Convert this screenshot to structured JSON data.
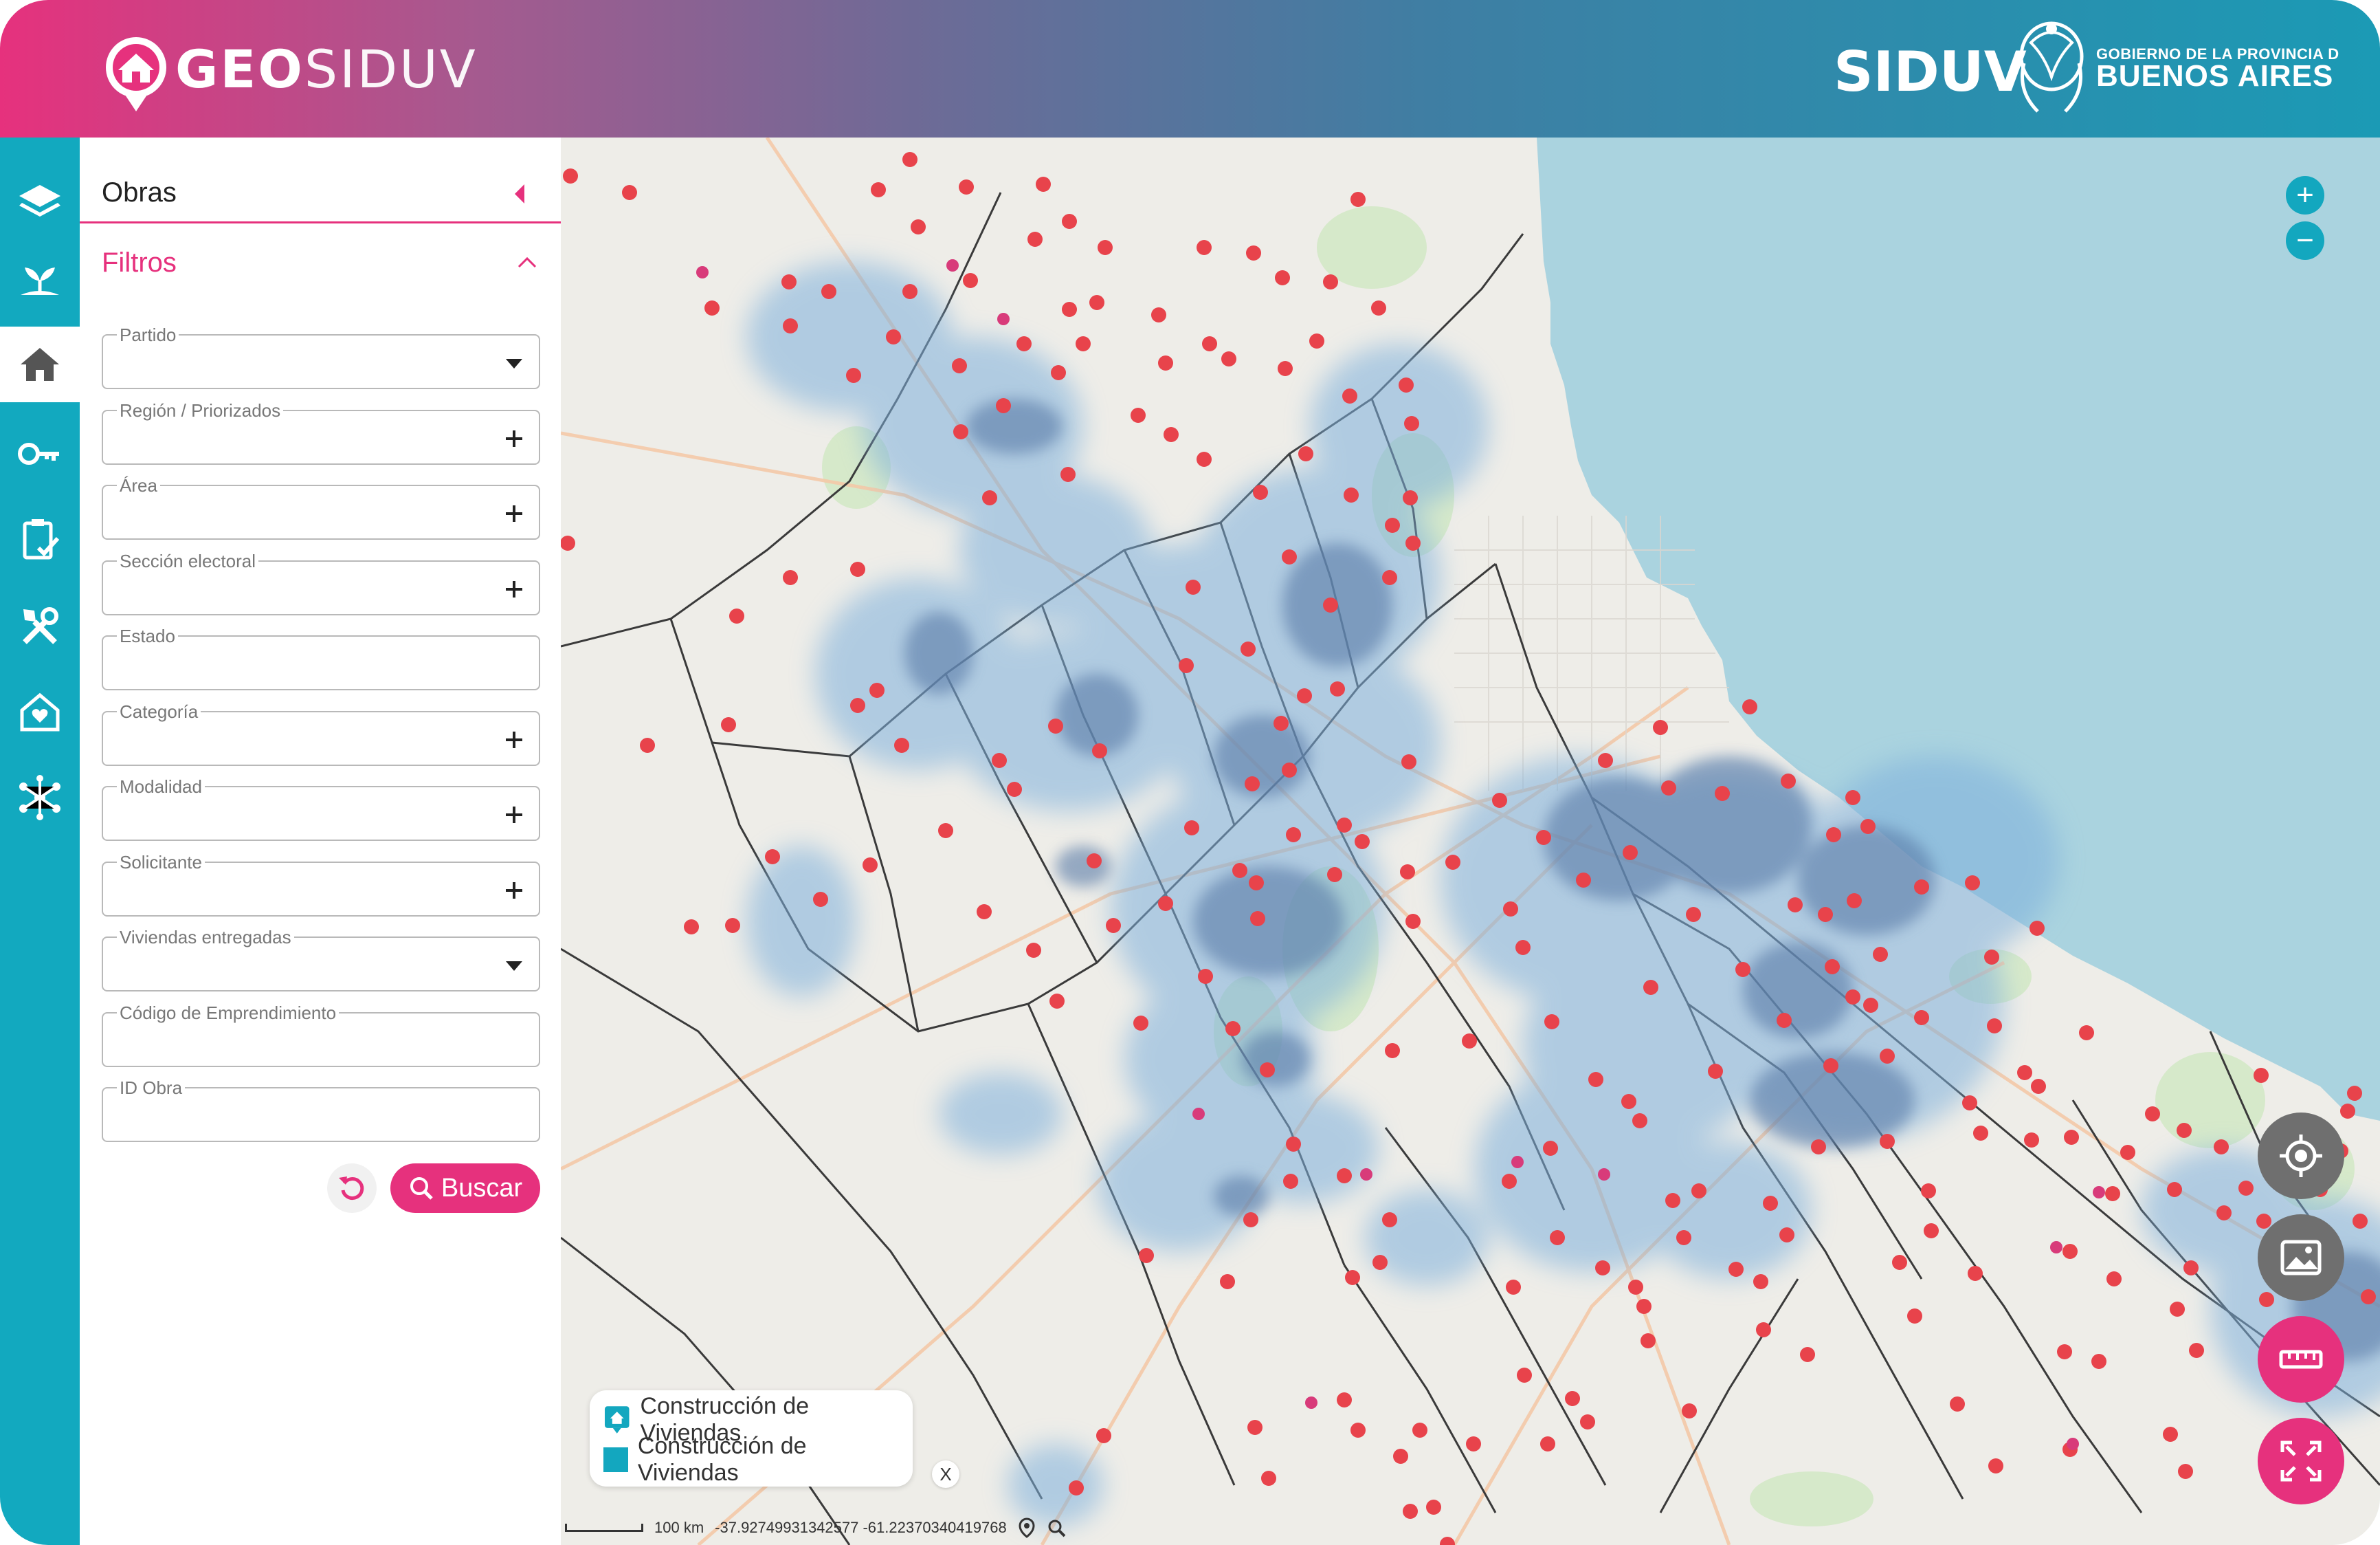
{
  "header": {
    "logo_bold": "GEO",
    "logo_thin": "SIDUV",
    "brand_word": "SIDUV",
    "gob_small": "GOBIERNO DE LA PROVINCIA D",
    "gob_big": "BUENOS AIRES"
  },
  "rail": {
    "items": [
      {
        "icon": "layers-icon",
        "active": false
      },
      {
        "icon": "sprout-icon",
        "active": false
      },
      {
        "icon": "home-icon",
        "active": true
      },
      {
        "icon": "key-icon",
        "active": false
      },
      {
        "icon": "clipboard-check-icon",
        "active": false
      },
      {
        "icon": "tools-icon",
        "active": false
      },
      {
        "icon": "house-heart-icon",
        "active": false
      },
      {
        "icon": "network-icon",
        "active": false
      }
    ]
  },
  "panel": {
    "title": "Obras",
    "filters_title": "Filtros",
    "fields": [
      {
        "label": "Partido",
        "control": "dropdown"
      },
      {
        "label": "Región / Priorizados",
        "control": "plus"
      },
      {
        "label": "Área",
        "control": "plus"
      },
      {
        "label": "Sección electoral",
        "control": "plus"
      },
      {
        "label": "Estado",
        "control": "none"
      },
      {
        "label": "Categoría",
        "control": "plus"
      },
      {
        "label": "Modalidad",
        "control": "plus"
      },
      {
        "label": "Solicitante",
        "control": "plus"
      },
      {
        "label": "Viviendas entregadas",
        "control": "dropdown"
      },
      {
        "label": "Código de Emprendimiento",
        "control": "none"
      },
      {
        "label": "ID Obra",
        "control": "none"
      }
    ],
    "search_label": "Buscar"
  },
  "map": {
    "zoom_in": "+",
    "zoom_out": "−",
    "legend": [
      {
        "label": "Construcción de Viviendas",
        "swatch": "pin"
      },
      {
        "label": "Construcción de Viviendas",
        "swatch": "square"
      }
    ],
    "legend_close": "X",
    "scale_label": "100 km",
    "coords": "-37.92749931342577 -61.22370340419768"
  },
  "colors": {
    "pink": "#e6317d",
    "teal": "#12a9bf",
    "water": "#aad3df",
    "marker": "#e8434b"
  }
}
